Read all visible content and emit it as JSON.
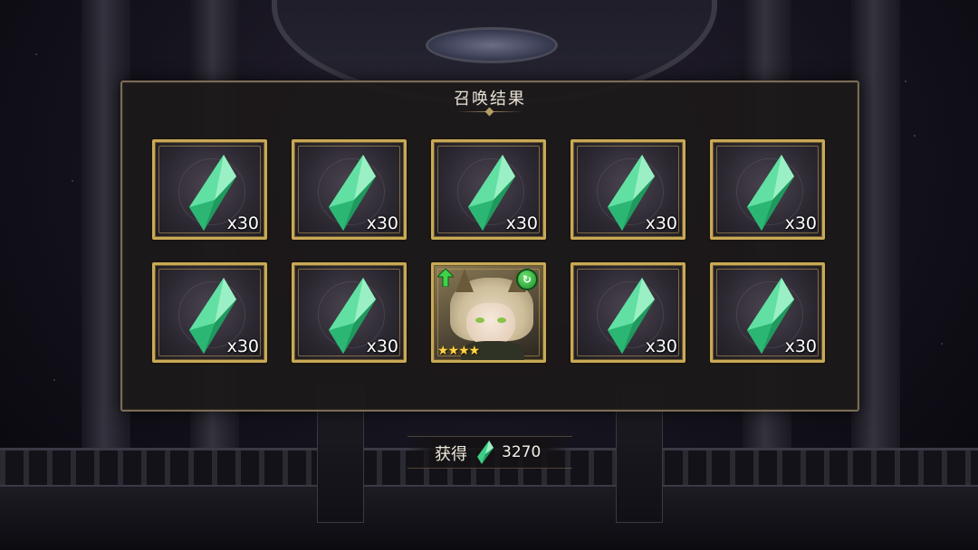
{
  "panel": {
    "title": "召唤结果"
  },
  "results": [
    {
      "type": "crystal",
      "quantity": "x30"
    },
    {
      "type": "crystal",
      "quantity": "x30"
    },
    {
      "type": "crystal",
      "quantity": "x30"
    },
    {
      "type": "crystal",
      "quantity": "x30"
    },
    {
      "type": "crystal",
      "quantity": "x30"
    },
    {
      "type": "crystal",
      "quantity": "x30"
    },
    {
      "type": "crystal",
      "quantity": "x30"
    },
    {
      "type": "character",
      "stars": "★★★★",
      "element_icon": "wind-element-icon",
      "badge": "up-arrow-icon"
    },
    {
      "type": "crystal",
      "quantity": "x30"
    },
    {
      "type": "crystal",
      "quantity": "x30"
    }
  ],
  "obtained": {
    "label": "获得",
    "icon": "green-crystal-icon",
    "value": "3270"
  },
  "colors": {
    "frame_gold": "#c9a957",
    "crystal_green": "#3ecf86",
    "star_gold": "#ffd54a"
  }
}
